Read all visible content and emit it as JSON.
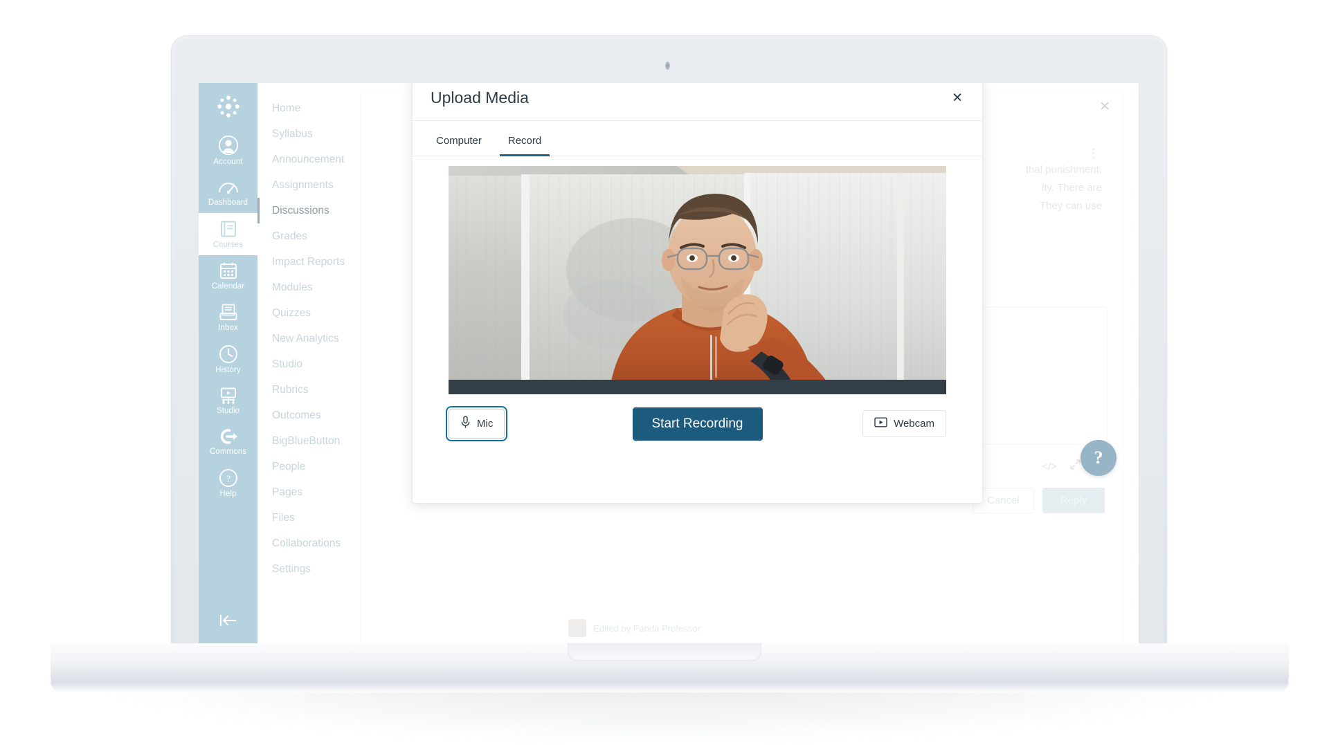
{
  "global_nav": {
    "logo_name": "canvas-logo",
    "items": [
      {
        "label": "Account",
        "icon": "account-avatar-icon",
        "active": false
      },
      {
        "label": "Dashboard",
        "icon": "dashboard-icon",
        "active": false
      },
      {
        "label": "Courses",
        "icon": "courses-book-icon",
        "active": true
      },
      {
        "label": "Calendar",
        "icon": "calendar-icon",
        "active": false
      },
      {
        "label": "Inbox",
        "icon": "inbox-icon",
        "active": false
      },
      {
        "label": "History",
        "icon": "clock-icon",
        "active": false
      },
      {
        "label": "Studio",
        "icon": "studio-icon",
        "active": false
      },
      {
        "label": "Commons",
        "icon": "commons-arrow-icon",
        "active": false
      },
      {
        "label": "Help",
        "icon": "help-question-icon",
        "active": false
      }
    ],
    "collapse_icon": "collapse-left-arrow-icon"
  },
  "course_nav": {
    "items": [
      {
        "label": "Home",
        "active": false
      },
      {
        "label": "Syllabus",
        "active": false
      },
      {
        "label": "Announcements",
        "active": false
      },
      {
        "label": "Assignments",
        "active": false
      },
      {
        "label": "Discussions",
        "active": true
      },
      {
        "label": "Grades",
        "active": false
      },
      {
        "label": "Impact Reports",
        "active": false
      },
      {
        "label": "Modules",
        "active": false
      },
      {
        "label": "Quizzes",
        "active": false
      },
      {
        "label": "New Analytics",
        "active": false
      },
      {
        "label": "Studio",
        "active": false
      },
      {
        "label": "Rubrics",
        "active": false
      },
      {
        "label": "Outcomes",
        "active": false
      },
      {
        "label": "BigBlueButton",
        "active": false
      },
      {
        "label": "People",
        "active": false
      },
      {
        "label": "Pages",
        "active": false
      },
      {
        "label": "Files",
        "active": false
      },
      {
        "label": "Collaborations",
        "active": false
      },
      {
        "label": "Settings",
        "active": false
      }
    ]
  },
  "background_page": {
    "close_icon": "close-icon",
    "kebab_icon": "more-options-icon",
    "text_lines": [
      "thal punishment.",
      "ity. There are",
      "They can use"
    ],
    "toolbar_icons": [
      "code-embed-icon",
      "expand-arrows-icon",
      "resize-grip-icon"
    ],
    "cancel_label": "Cancel",
    "reply_label": "Reply",
    "edited_by": "Edited by Panda Professor",
    "help_bubble_label": "?"
  },
  "modal": {
    "title": "Upload Media",
    "close_icon": "close-icon",
    "tabs": [
      {
        "label": "Computer",
        "active": false
      },
      {
        "label": "Record",
        "active": true
      }
    ],
    "preview": {
      "name": "webcam-video-preview"
    },
    "controls": {
      "mic_label": "Mic",
      "mic_icon": "microphone-icon",
      "start_recording_label": "Start Recording",
      "webcam_label": "Webcam",
      "webcam_icon": "webcam-play-icon"
    }
  },
  "colors": {
    "brand_blue": "#1c5b7e",
    "tab_underline": "#1c6288",
    "global_nav_bg": "#b5d2de",
    "video_bottom_bar": "#333f48",
    "help_bubble": "#1a5b83"
  }
}
